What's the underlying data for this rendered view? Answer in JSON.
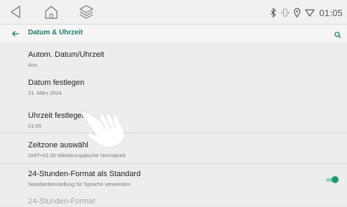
{
  "status": {
    "time": "01:05",
    "icons": [
      "bluetooth-icon",
      "vibrate-icon",
      "location-icon",
      "wifi-icon"
    ]
  },
  "nav": {
    "icons": [
      "back-icon",
      "home-icon",
      "layers-icon"
    ]
  },
  "appbar": {
    "title": "Datum & Uhrzeit",
    "accent": "#1a7f64"
  },
  "settings": [
    {
      "title": "Autom. Datum/Uhrzeit",
      "subtitle": "Aus"
    },
    {
      "title": "Datum festlegen",
      "subtitle": "21. März 2024"
    },
    {
      "title": "Uhrzeit festlegen",
      "subtitle": "01:05"
    },
    {
      "title": "Zeitzone auswähl",
      "subtitle": "GMT+01:00 Mitteleuropäische Normalzeit"
    },
    {
      "title": "24-Stunden-Format als Standard",
      "subtitle": "Standardeinstellung für Sprache verwenden",
      "toggle": true
    },
    {
      "title": "24-Stunden-Format",
      "subtitle": ""
    }
  ]
}
